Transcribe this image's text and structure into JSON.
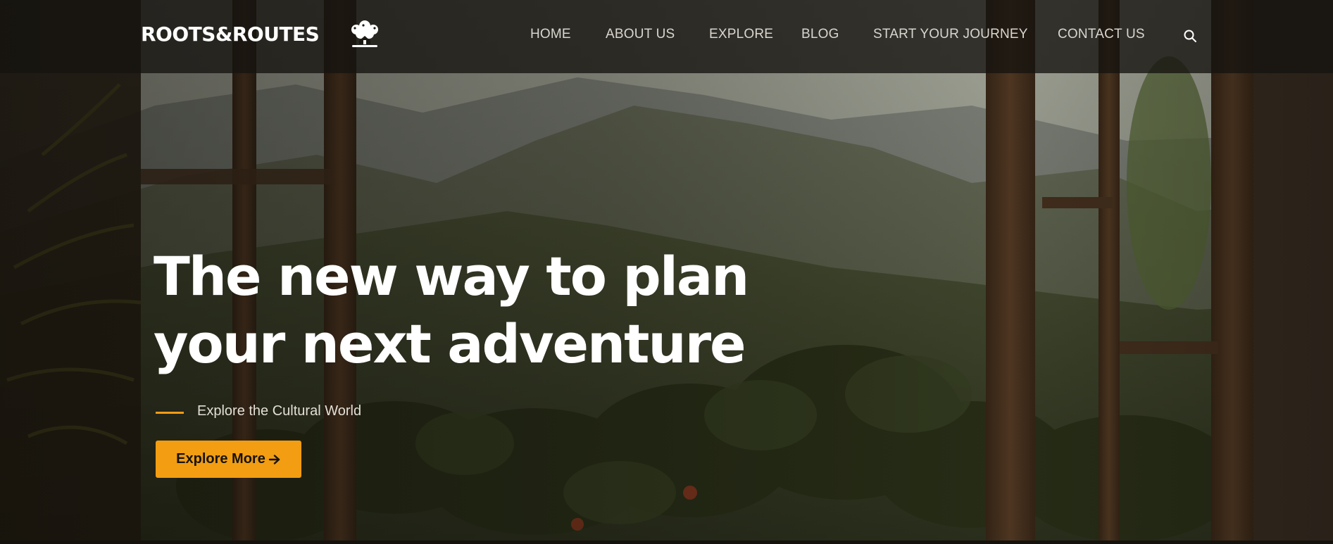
{
  "header": {
    "brand": "ROOTS&ROUTES",
    "logo_icon": "tree-house-icon",
    "nav": [
      {
        "label": "HOME"
      },
      {
        "label": "ABOUT US"
      },
      {
        "label": "EXPLORE"
      },
      {
        "label": "BLOG"
      },
      {
        "label": "START YOUR JOURNEY"
      },
      {
        "label": "CONTACT US"
      }
    ],
    "search_icon": "search-icon"
  },
  "hero": {
    "headline_line1": "The new way to plan",
    "headline_line2": "your next adventure",
    "tagline": "Explore the Cultural World",
    "cta_label": "Explore More",
    "cta_icon": "arrow-right-icon",
    "background": "mountain-view-through-window"
  },
  "colors": {
    "accent": "#f29d12",
    "header_bg": "#16130f",
    "text_light": "#ffffff"
  }
}
